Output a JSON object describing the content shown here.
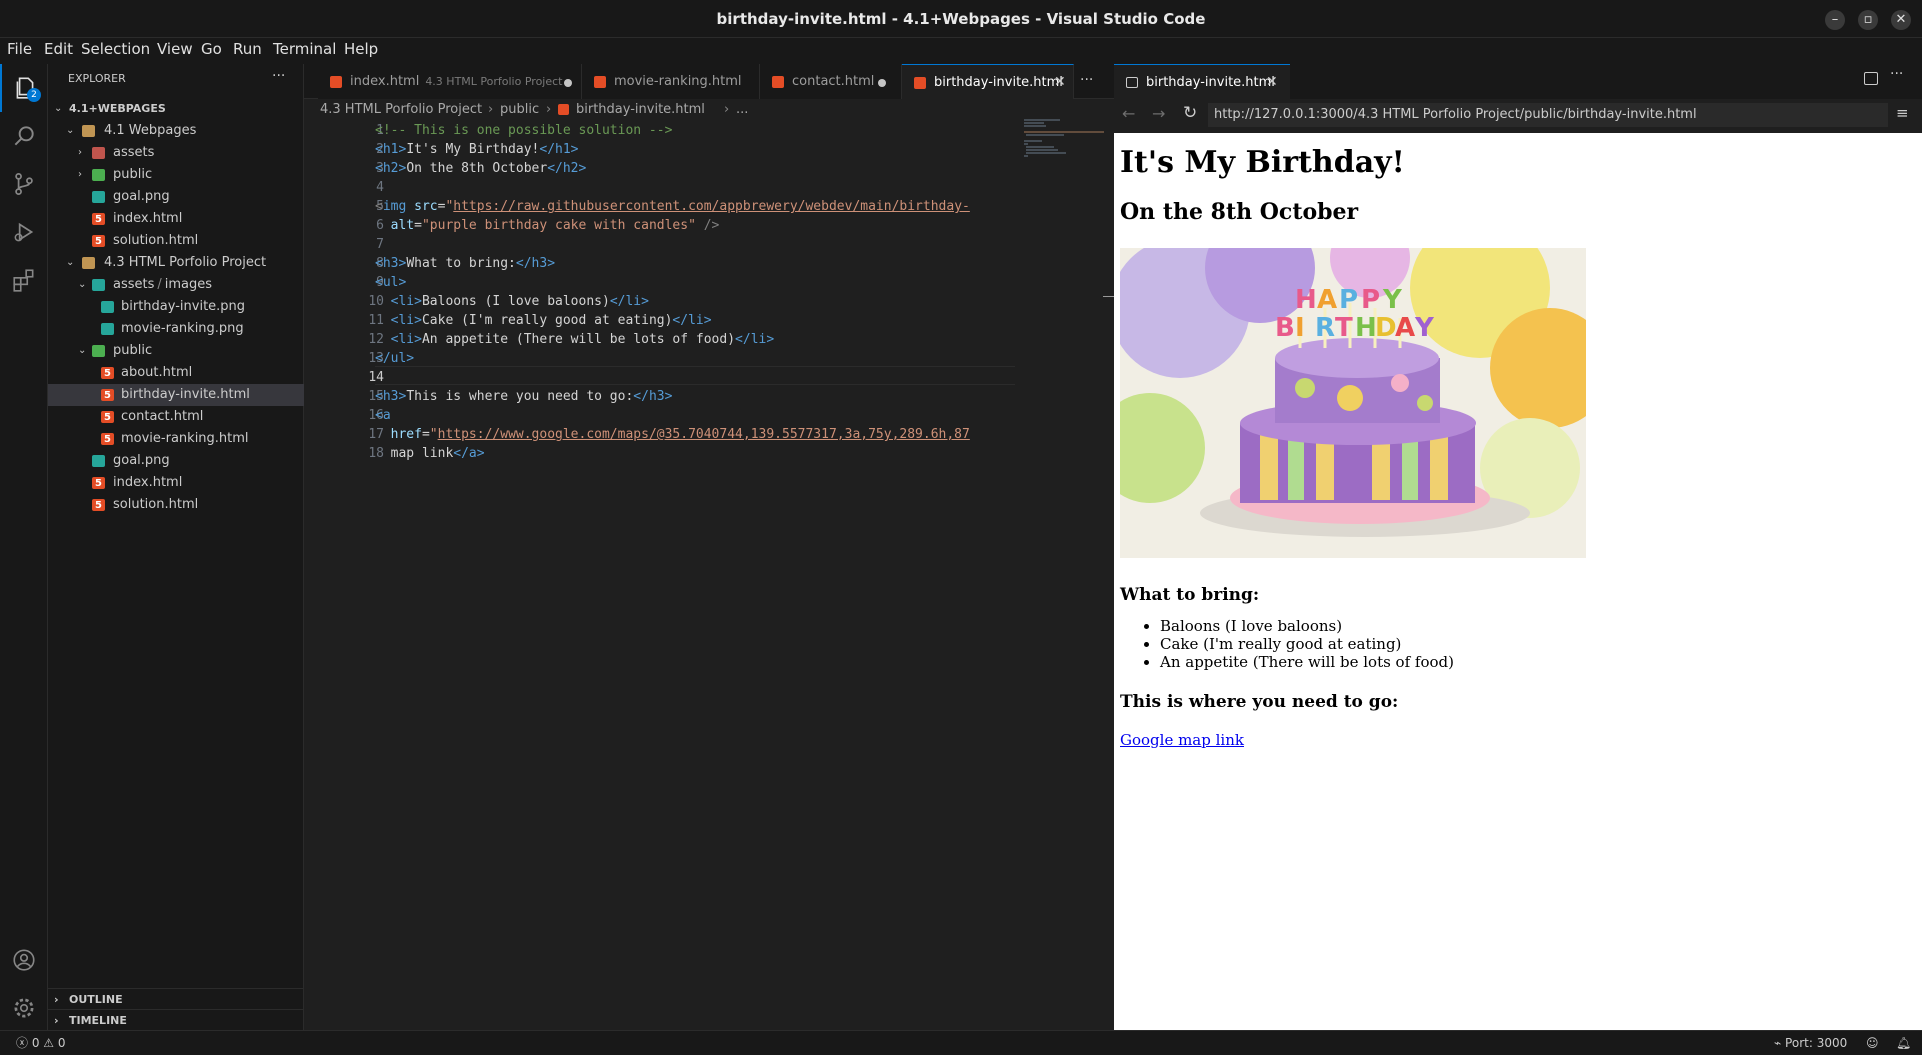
{
  "window": {
    "title": "birthday-invite.html - 4.1+Webpages - Visual Studio Code"
  },
  "menu": [
    "File",
    "Edit",
    "Selection",
    "View",
    "Go",
    "Run",
    "Terminal",
    "Help"
  ],
  "activity": {
    "explorer_badge": "2"
  },
  "sidebar": {
    "header": "EXPLORER",
    "root": "4.1+WEBPAGES",
    "tree": [
      {
        "label": "4.1 Webpages",
        "type": "folder",
        "expanded": true
      },
      {
        "label": "assets",
        "type": "folder",
        "expanded": false
      },
      {
        "label": "public",
        "type": "folder",
        "expanded": false
      },
      {
        "label": "goal.png",
        "type": "png"
      },
      {
        "label": "index.html",
        "type": "html"
      },
      {
        "label": "solution.html",
        "type": "html"
      },
      {
        "label": "4.3 HTML Porfolio Project",
        "type": "folder",
        "expanded": true
      },
      {
        "label": "assets",
        "sep": "/",
        "label2": "images",
        "type": "folder",
        "expanded": true
      },
      {
        "label": "birthday-invite.png",
        "type": "png"
      },
      {
        "label": "movie-ranking.png",
        "type": "png"
      },
      {
        "label": "public",
        "type": "folder",
        "expanded": true
      },
      {
        "label": "about.html",
        "type": "html"
      },
      {
        "label": "birthday-invite.html",
        "type": "html",
        "selected": true
      },
      {
        "label": "contact.html",
        "type": "html"
      },
      {
        "label": "movie-ranking.html",
        "type": "html"
      },
      {
        "label": "goal.png",
        "type": "png"
      },
      {
        "label": "index.html",
        "type": "html"
      },
      {
        "label": "solution.html",
        "type": "html"
      }
    ],
    "outline": "OUTLINE",
    "timeline": "TIMELINE"
  },
  "tabs": [
    {
      "label": "index.html",
      "desc": "4.3 HTML Porfolio Project",
      "dirty": true
    },
    {
      "label": "movie-ranking.html",
      "dirty": false
    },
    {
      "label": "contact.html",
      "dirty": true
    },
    {
      "label": "birthday-invite.html",
      "active": true
    }
  ],
  "breadcrumb": {
    "a": "4.3 HTML Porfolio Project",
    "b": "public",
    "c": "birthday-invite.html",
    "d": "..."
  },
  "code": {
    "line_numbers": [
      "1",
      "2",
      "3",
      "4",
      "5",
      "6",
      "7",
      "8",
      "9",
      "10",
      "11",
      "12",
      "13",
      "14",
      "15",
      "16",
      "17",
      "18"
    ],
    "current_line": "14",
    "l1": "<!-- This is one possible solution -->",
    "l2_open": "<h1>",
    "l2_text": "It's My Birthday!",
    "l2_close": "</h1>",
    "l3_open": "<h2>",
    "l3_text": "On the 8th October",
    "l3_close": "</h2>",
    "l5_tag": "img",
    "l5_attr": "src",
    "l5_url": "https://raw.githubusercontent.com/appbrewery/webdev/main/birthday-",
    "l6_attr": "alt",
    "l6_val": "\"purple birthday cake with candles\"",
    "l8_text": "What to bring:",
    "l10_text": "Baloons (I love baloons)",
    "l11_text": "Cake (I'm really good at eating)",
    "l12_text": "An appetite (There will be lots of food)",
    "l15_text": "This is where you need to go:",
    "l17_attr": "href",
    "l17_url": "https://www.google.com/maps/@35.7040744,139.5577317,3a,75y,289.6h,87",
    "l18_text": "map link"
  },
  "preview": {
    "tab_label": "birthday-invite.html",
    "url": "http://127.0.0.1:3000/4.3 HTML Porfolio Project/public/birthday-invite.html",
    "h1": "It's My Birthday!",
    "h2": "On the 8th October",
    "cake_alt": "purple birthday cake with candles",
    "cake_letters": [
      "H",
      "A",
      "P",
      "P",
      "Y"
    ],
    "cake_letters2": [
      "B",
      "I",
      "R",
      "T",
      "H",
      "D",
      "A",
      "Y"
    ],
    "bring_heading": "What to bring:",
    "items": [
      "Baloons (I love baloons)",
      "Cake (I'm really good at eating)",
      "An appetite (There will be lots of food)"
    ],
    "where_heading": "This is where you need to go:",
    "map_link": "Google map link"
  },
  "status": {
    "errors": "0",
    "warnings": "0",
    "port": "Port: 3000"
  },
  "colors": {
    "accent": "#0078d4",
    "html_icon": "#e44d26"
  }
}
